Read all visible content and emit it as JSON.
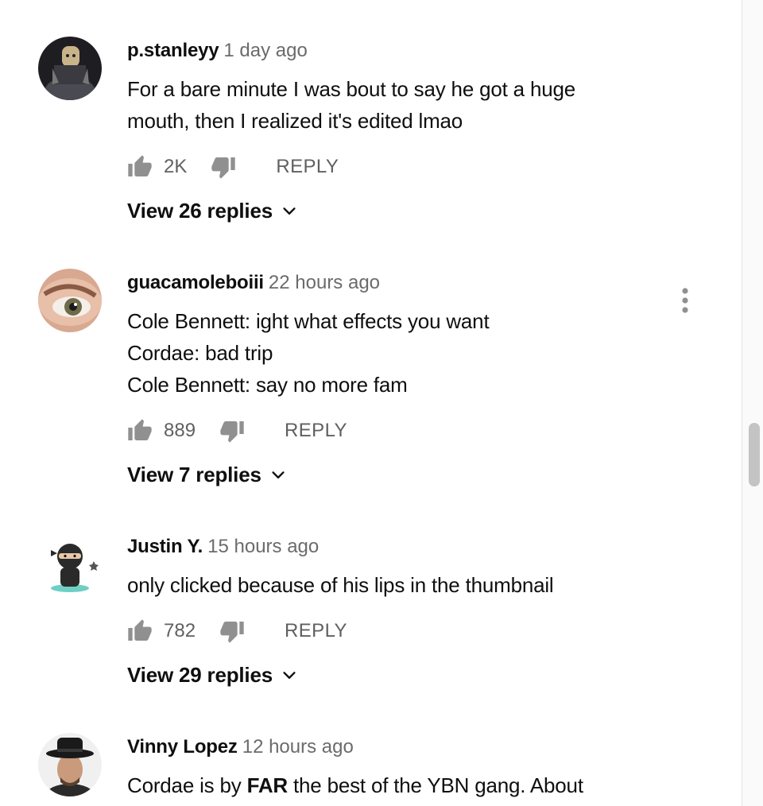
{
  "comments": [
    {
      "author": "p.stanleyy",
      "time": "1 day ago",
      "lines": [
        "For a bare minute I was bout to say he got a huge",
        "mouth, then I realized it's edited lmao"
      ],
      "likes": "2K",
      "reply_label": "REPLY",
      "view_replies": "View 26 replies"
    },
    {
      "author": "guacamoleboiii",
      "time": "22 hours ago",
      "lines": [
        "Cole Bennett: ight what effects you want",
        "Cordae: bad trip",
        "Cole Bennett: say no more fam"
      ],
      "likes": "889",
      "reply_label": "REPLY",
      "view_replies": "View 7 replies"
    },
    {
      "author": "Justin Y.",
      "time": "15 hours ago",
      "lines": [
        "only clicked because of his lips in the thumbnail"
      ],
      "likes": "782",
      "reply_label": "REPLY",
      "view_replies": "View 29 replies"
    },
    {
      "author": "Vinny Lopez",
      "time": "12 hours ago",
      "line_parts": [
        "Cordae is by ",
        "FAR",
        " the best of the YBN gang. About"
      ]
    }
  ],
  "icons": {
    "like": "thumbs-up-icon",
    "dislike": "thumbs-down-icon",
    "expand": "chevron-down-icon",
    "menu": "more-vert-icon"
  },
  "colors": {
    "icon": "#909090",
    "secondary_text": "#606060",
    "scroll_thumb": "#c4c4c4"
  }
}
